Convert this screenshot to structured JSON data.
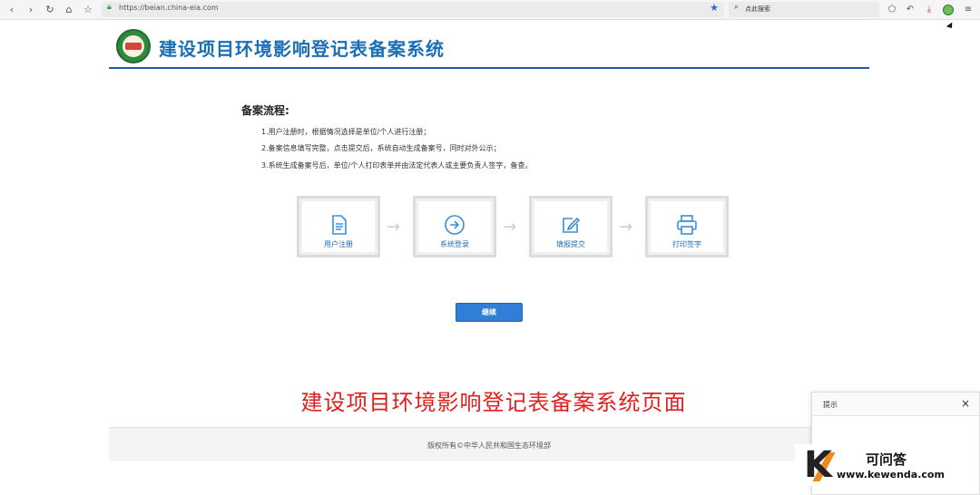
{
  "browser": {
    "url": "https://beian.china-eia.com",
    "search_placeholder": "点此搜索"
  },
  "site": {
    "title": "建设项目环境影响登记表备案系统"
  },
  "process": {
    "heading": "备案流程:",
    "steps": [
      "1.用户注册时，根据情况选择是单位/个人进行注册；",
      "2.备案信息填写完整，点击提交后，系统自动生成备案号，同时对外公示；",
      "3.系统生成备案号后，单位/个人打印表单并由法定代表人或主要负责人签字，备查。"
    ],
    "cards": [
      {
        "label": "用户注册",
        "icon": "document-icon"
      },
      {
        "label": "系统登录",
        "icon": "arrow-circle-icon"
      },
      {
        "label": "填报提交",
        "icon": "edit-icon"
      },
      {
        "label": "打印签字",
        "icon": "printer-icon"
      }
    ]
  },
  "continue_label": "继续",
  "caption": "建设项目环境影响登记表备案系统页面",
  "footer": "版权所有©中华人民共和国生态环境部",
  "popup": {
    "title": "提示"
  },
  "watermark": {
    "name": "可问答",
    "url": "www.kewenda.com",
    "letter": "K"
  },
  "colors": {
    "accent": "#1c6fb5",
    "caption": "#e02020",
    "button": "#2f7fd9"
  }
}
